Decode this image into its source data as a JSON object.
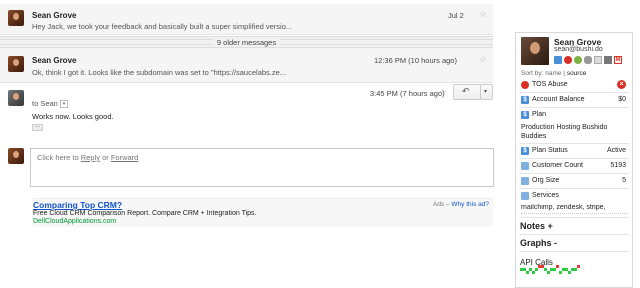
{
  "thread": {
    "messages": [
      {
        "sender": "Sean Grove",
        "snippet": "Hey Jack, we took your feedback and basically built a super simplified versio...",
        "date": "Jul 2"
      },
      {
        "sender": "Sean Grove",
        "snippet": "Ok, think I got it. Looks like the subdomain was set to \"https://saucelabs.ze...",
        "date": "12:36 PM (10 hours ago)"
      }
    ],
    "older_label": "9 older messages",
    "open_message": {
      "to": "to Sean",
      "body": "Works now. Looks good.",
      "date": "3:45 PM (7 hours ago)",
      "ellipsis": "..."
    },
    "reply": {
      "prefix": "Click here to",
      "reply": "Reply",
      "or": "or",
      "forward": "Forward"
    }
  },
  "ad": {
    "title": "Comparing Top CRM?",
    "text": "Free Cloud CRM Comparison Report. Compare CRM + Integration Tips.",
    "url": "DellCloudApplications.com",
    "ads_label": "Ads –",
    "why_label": "Why this ad?"
  },
  "sidebar": {
    "name": "Sean Grove",
    "email": "sean@bushi.do",
    "sort_prefix": "Sort by:",
    "sort_name": "name",
    "sort_sep": "|",
    "sort_source": "source",
    "tos": "TOS Abuse",
    "account_balance": {
      "label": "Account Balance",
      "value": "$0"
    },
    "plan": {
      "label": "Plan",
      "value": "Production Hosting Bushido Buddies"
    },
    "plan_status": {
      "label": "Plan Status",
      "value": "Active"
    },
    "customer_count": {
      "label": "Customer Count",
      "value": "5193"
    },
    "org_size": {
      "label": "Org Size",
      "value": "5"
    },
    "services": {
      "label": "Services",
      "value": "mailchimp, zendesk, stripe,"
    },
    "notes": "Notes +",
    "graphs": "Graphs -",
    "api_calls": "API Calls",
    "api_calls_series": [
      0.5,
      0.5,
      0.0,
      0.5,
      0.0,
      0.5,
      1.0,
      1.0,
      0.5,
      0.0,
      0.5,
      0.5,
      1.0,
      0.0,
      0.5,
      0.5,
      0.0,
      0.5,
      0.5,
      1.0
    ],
    "colors": {
      "accent": "#4a90d9",
      "alert": "#d93025",
      "spark_green": "#2ecc40",
      "spark_red": "#e53935"
    }
  }
}
